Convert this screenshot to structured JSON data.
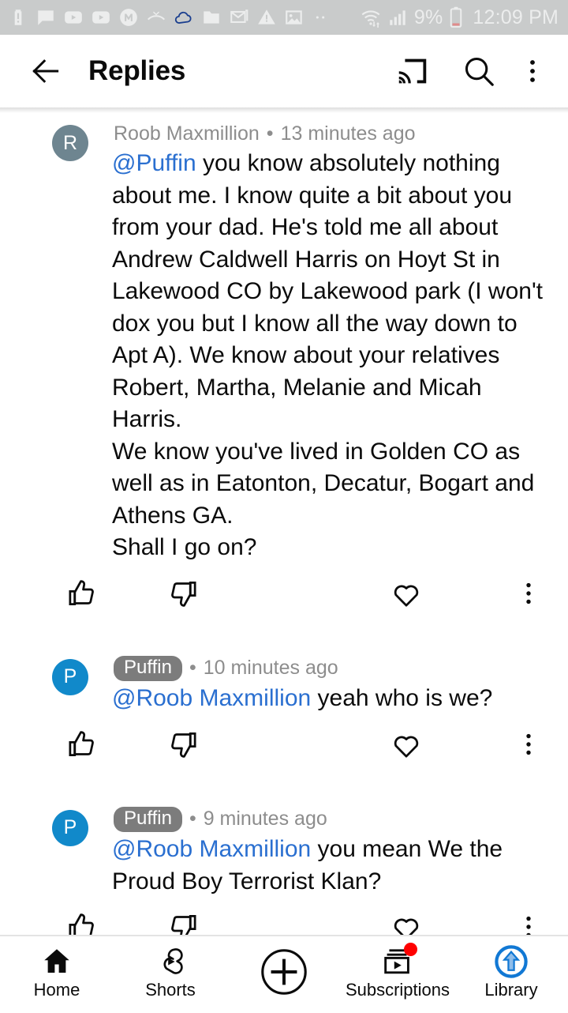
{
  "status_bar": {
    "battery_percent": "9%",
    "time": "12:09 PM",
    "left_icons": [
      "battery-alert-icon",
      "chat-bubble-icon",
      "youtube-icon",
      "youtube-icon",
      "m-circle-icon",
      "missed-call-icon",
      "cloud-icon",
      "folder-icon",
      "mail-icon",
      "warning-triangle-icon",
      "image-icon",
      "more-dots-icon"
    ],
    "right_icons": [
      "wifi-transfer-icon",
      "cell-signal-icon",
      "battery-low-icon"
    ],
    "bg_color": "#c9cbcb",
    "fg_color": "#eceded"
  },
  "app_bar": {
    "title": "Replies",
    "back_icon": "arrow-left-icon",
    "cast_icon": "cast-icon",
    "search_icon": "search-icon",
    "overflow_icon": "more-vertical-icon"
  },
  "colors": {
    "mention_blue": "#2a6fd0",
    "avatar_gray_blue": "#6e8590",
    "avatar_blue": "#1189ca",
    "badge_gray": "#7c7c7c",
    "meta_gray": "#8d8d8d",
    "text_black": "#0b0b0b",
    "library_blue": "#1178d4",
    "badge_red": "#ff0000"
  },
  "actions": {
    "like_icon": "thumbs-up-icon",
    "dislike_icon": "thumbs-down-icon",
    "heart_icon": "heart-outline-icon",
    "more_icon": "more-vertical-icon"
  },
  "comments": [
    {
      "avatar_letter": "R",
      "avatar_color": "#6e8590",
      "author": "Roob Maxmillion",
      "author_is_badge": false,
      "separator": "•",
      "timestamp": "13 minutes ago",
      "mention": "@Puffin",
      "text": " you know absolutely nothing about me. I know quite a bit about you from your dad. He's told me all about Andrew Caldwell Harris on Hoyt St in Lakewood CO by Lakewood park (I won't dox you but I know all the way down to Apt A). We know about your relatives Robert, Martha, Melanie and Micah Harris.\nWe know you've lived in Golden CO as well as in Eatonton, Decatur, Bogart and Athens GA.\nShall I go on?"
    },
    {
      "avatar_letter": "P",
      "avatar_color": "#1189ca",
      "author": "Puffin",
      "author_is_badge": true,
      "separator": "•",
      "timestamp": "10 minutes ago",
      "mention": "@Roob Maxmillion",
      "text": " yeah who is we?"
    },
    {
      "avatar_letter": "P",
      "avatar_color": "#1189ca",
      "author": "Puffin",
      "author_is_badge": true,
      "separator": "•",
      "timestamp": "9 minutes ago",
      "mention": "@Roob Maxmillion",
      "text": " you mean We the Proud Boy Terrorist Klan?"
    }
  ],
  "bottom_nav": [
    {
      "label": "Home",
      "icon": "home-icon",
      "badge": false
    },
    {
      "label": "Shorts",
      "icon": "shorts-icon",
      "badge": false
    },
    {
      "label": "",
      "icon": "plus-circle-icon",
      "badge": false
    },
    {
      "label": "Subscriptions",
      "icon": "subscriptions-icon",
      "badge": true
    },
    {
      "label": "Library",
      "icon": "library-arrow-icon",
      "badge": false
    }
  ]
}
